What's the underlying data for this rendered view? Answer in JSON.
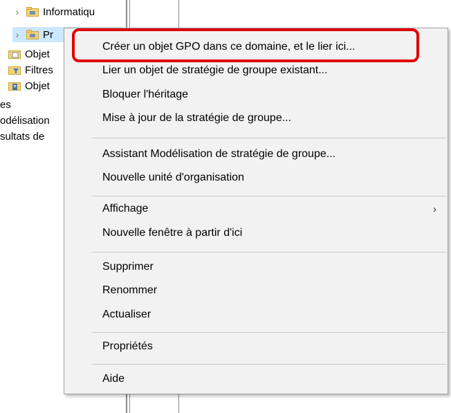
{
  "tree": {
    "items": [
      {
        "label": "Informatiqu"
      },
      {
        "label": "Pr"
      },
      {
        "label": "Objet"
      },
      {
        "label": "Filtres"
      },
      {
        "label": "Objet"
      },
      {
        "label": "es"
      },
      {
        "label": "odélisation"
      },
      {
        "label": "sultats de"
      }
    ]
  },
  "menu": {
    "items": [
      {
        "label": "Créer un objet GPO dans ce domaine, et le lier ici..."
      },
      {
        "label": "Lier un objet de stratégie de groupe existant..."
      },
      {
        "label": "Bloquer l'héritage"
      },
      {
        "label": "Mise à jour de la stratégie de groupe..."
      },
      {
        "label": "Assistant Modélisation de stratégie de groupe..."
      },
      {
        "label": "Nouvelle unité d'organisation"
      },
      {
        "label": "Affichage",
        "submenu_glyph": "›"
      },
      {
        "label": "Nouvelle fenêtre à partir d'ici"
      },
      {
        "label": "Supprimer"
      },
      {
        "label": "Renommer"
      },
      {
        "label": "Actualiser"
      },
      {
        "label": "Propriétés"
      },
      {
        "label": "Aide"
      }
    ]
  },
  "colors": {
    "highlight": "#e00000",
    "menu_bg": "#f2f2f2",
    "folder": "#e8c25a"
  }
}
